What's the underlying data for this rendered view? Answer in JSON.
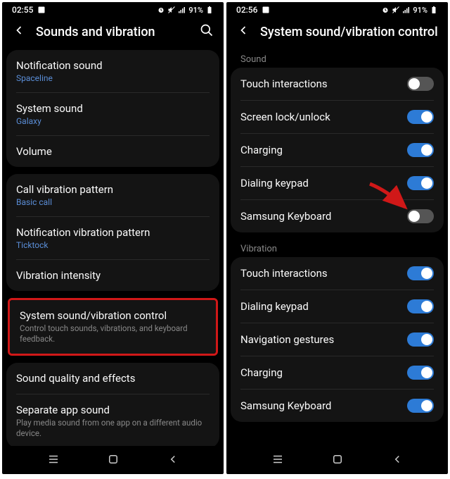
{
  "left": {
    "status": {
      "time": "02:55",
      "battery": "91%"
    },
    "title": "Sounds and vibration",
    "groups": [
      {
        "items": [
          {
            "title": "Notification sound",
            "sub": "Spaceline"
          },
          {
            "title": "System sound",
            "sub": "Galaxy"
          },
          {
            "title": "Volume"
          }
        ]
      },
      {
        "items": [
          {
            "title": "Call vibration pattern",
            "sub": "Basic call"
          },
          {
            "title": "Notification vibration pattern",
            "sub": "Ticktock"
          },
          {
            "title": "Vibration intensity"
          }
        ]
      },
      {
        "highlighted": true,
        "items": [
          {
            "title": "System sound/vibration control",
            "desc": "Control touch sounds, vibrations, and keyboard feedback."
          }
        ]
      },
      {
        "items": [
          {
            "title": "Sound quality and effects"
          },
          {
            "title": "Separate app sound",
            "desc": "Play media sound from one app on a different audio device."
          }
        ]
      }
    ]
  },
  "right": {
    "status": {
      "time": "02:56",
      "battery": "91%"
    },
    "title": "System sound/vibration control",
    "sections": [
      {
        "header": "Sound",
        "items": [
          {
            "title": "Touch interactions",
            "on": false
          },
          {
            "title": "Screen lock/unlock",
            "on": true
          },
          {
            "title": "Charging",
            "on": true
          },
          {
            "title": "Dialing keypad",
            "on": true
          },
          {
            "title": "Samsung Keyboard",
            "on": false,
            "arrow": true
          }
        ]
      },
      {
        "header": "Vibration",
        "items": [
          {
            "title": "Touch interactions",
            "on": true
          },
          {
            "title": "Dialing keypad",
            "on": true
          },
          {
            "title": "Navigation gestures",
            "on": true
          },
          {
            "title": "Charging",
            "on": true
          },
          {
            "title": "Samsung Keyboard",
            "on": true
          }
        ]
      }
    ]
  }
}
